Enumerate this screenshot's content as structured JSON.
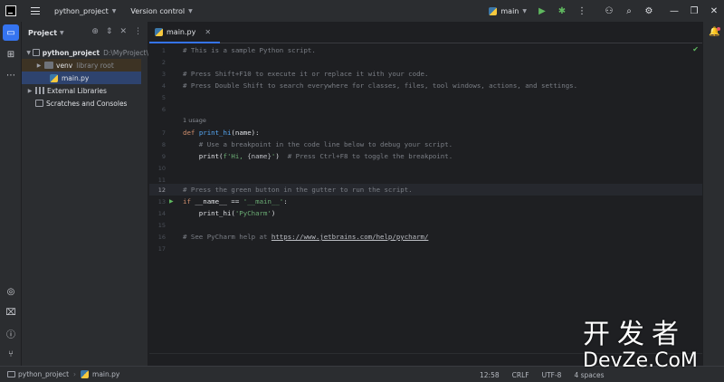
{
  "titlebar": {
    "project_name": "python_project",
    "vcs_menu": "Version control",
    "run_config": "main"
  },
  "project_panel": {
    "title": "Project",
    "tree": [
      {
        "label": "python_project",
        "hint": "D:\\MyProject\\"
      },
      {
        "label": "venv",
        "hint": "library root"
      },
      {
        "label": "main.py",
        "hint": ""
      },
      {
        "label": "External Libraries",
        "hint": ""
      },
      {
        "label": "Scratches and Consoles",
        "hint": ""
      }
    ]
  },
  "editor": {
    "tab_label": "main.py",
    "usage_hint": "1 usage",
    "line_numbers": [
      "1",
      "2",
      "3",
      "4",
      "5",
      "6",
      "7",
      "8",
      "9",
      "10",
      "11",
      "12",
      "13",
      "14",
      "15",
      "16",
      "17"
    ],
    "current_line": "12",
    "code": {
      "l1": "# This is a sample Python script.",
      "l3": "# Press Shift+F10 to execute it or replace it with your code.",
      "l4": "# Press Double Shift to search everywhere for classes, files, tool windows, actions, and settings.",
      "l7_kw": "def ",
      "l7_fn": "print_hi",
      "l7_rest": "(name):",
      "l8": "    # Use a breakpoint in the code line below to debug your script.",
      "l9_a": "    print(",
      "l9_s1": "f'Hi, ",
      "l9_p": "{name}",
      "l9_s2": "'",
      "l9_b": ")  ",
      "l9_c": "# Press Ctrl+F8 to toggle the breakpoint.",
      "l12": "# Press the green button in the gutter to run the script.",
      "l13_kw": "if ",
      "l13_a": "__name__ == ",
      "l13_s": "'__main__'",
      "l13_b": ":",
      "l14_a": "    print_hi(",
      "l14_s": "'PyCharm'",
      "l14_b": ")",
      "l16_c": "# See PyCharm help at ",
      "l16_link": "https://www.jetbrains.com/help/pycharm/"
    }
  },
  "statusbar": {
    "crumb_project": "python_project",
    "crumb_file": "main.py",
    "position": "12:58",
    "line_sep": "CRLF",
    "encoding": "UTF-8",
    "indent": "4 spaces"
  },
  "watermark": {
    "cn": "开发者",
    "en": "DevZe.CoM"
  },
  "colors": {
    "accent": "#3574f0",
    "run_green": "#5fb85f"
  }
}
